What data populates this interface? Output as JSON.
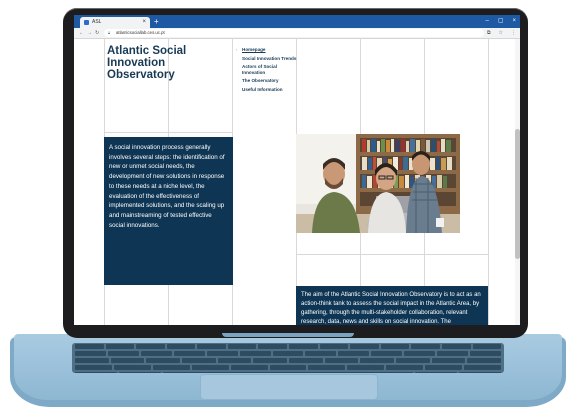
{
  "browser": {
    "tab_title": "ASL",
    "tab_close": "×",
    "new_tab": "+",
    "url": "atlanticsociallab.ces.uc.pt",
    "window_controls": [
      "–",
      "▢",
      "×"
    ]
  },
  "site": {
    "title": "Atlantic Social Innovation Observatory"
  },
  "menu": {
    "items": [
      {
        "label": "Homepage",
        "active": true
      },
      {
        "label": "Social Innovation Trends"
      },
      {
        "label": "Actors of Social Innovation"
      },
      {
        "label": "The Observatory"
      },
      {
        "label": "Useful Information"
      }
    ]
  },
  "content": {
    "intro_text": "A social innovation process generally involves several steps: the identification of new or unmet social needs, the development of new solutions in response to these needs at a niche level, the evaluation of the effectiveness of implemented solutions, and the scaling up and mainstreaming of tested effective social innovations.",
    "aim_text": "The aim of the Atlantic Social Innovation Observatory is to act as an action-think tank to assess the social impact in the Atlantic Area, by gathering, through the multi-stakeholder collaboration, relevant research, data, news and skills on social innovation. The observatory"
  },
  "colors": {
    "navy": "#0e3553",
    "title_blue": "#173a55",
    "chrome_blue": "#1e5aa3",
    "laptop_blue": "#9ec3dc"
  }
}
